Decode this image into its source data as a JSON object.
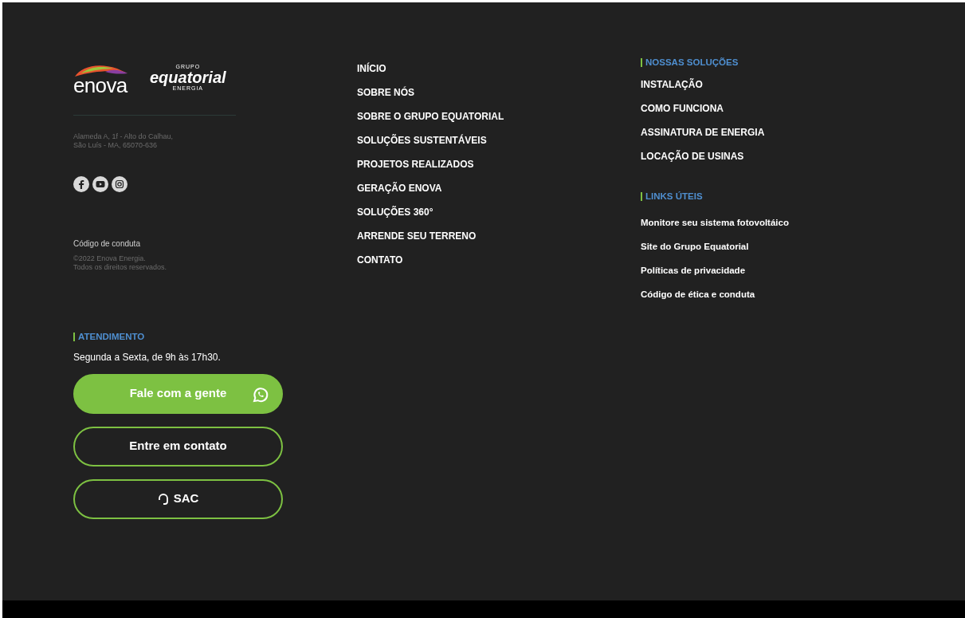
{
  "brand": {
    "enova": "enova",
    "group_small": "GRUPO",
    "group_name": "equatorial",
    "group_sub": "ENERGIA"
  },
  "address": [
    "Alameda A, 1f - Alto do Calhau,",
    "São Luís - MA, 65070-636"
  ],
  "conduct_link": "Código de conduta",
  "copyright": [
    "©2022 Enova Energia.",
    "Todos os direitos reservados."
  ],
  "support": {
    "heading": "ATENDIMENTO",
    "hours": "Segunda a Sexta, de 9h às 17h30.",
    "buttons": [
      {
        "label": "Fale com a gente",
        "kind": "whatsapp"
      },
      {
        "label": "Entre em contato",
        "kind": "outline"
      },
      {
        "label": "SAC",
        "kind": "sac"
      }
    ]
  },
  "nav": [
    "INÍCIO",
    "SOBRE NÓS",
    "SOBRE O GRUPO EQUATORIAL",
    "SOLUÇÕES SUSTENTÁVEIS",
    "PROJETOS REALIZADOS",
    "GERAÇÃO ENOVA",
    "SOLUÇÕES 360°",
    "ARRENDE SEU TERRENO",
    "CONTATO"
  ],
  "solutions": {
    "heading": "NOSSAS SOLUÇÕES",
    "items": [
      "INSTALAÇÃO",
      "COMO FUNCIONA",
      "ASSINATURA DE ENERGIA",
      "LOCAÇÃO DE USINAS"
    ]
  },
  "links": {
    "heading": "LINKS ÚTEIS",
    "items": [
      "Monitore seu sistema fotovoltáico",
      "Site do Grupo Equatorial",
      "Políticas de privacidade",
      "Código de ética e conduta"
    ]
  }
}
